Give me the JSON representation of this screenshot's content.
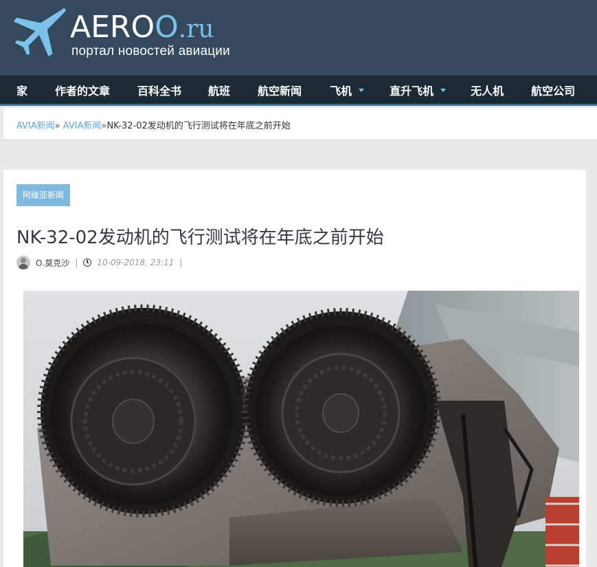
{
  "site": {
    "logo_main": "AERO",
    "logo_o": "O",
    "logo_tld": ".ru",
    "logo_subtitle": "портал новостей авиации"
  },
  "nav": {
    "items": [
      {
        "label": "家",
        "has_dropdown": false
      },
      {
        "label": "作者的文章",
        "has_dropdown": false
      },
      {
        "label": "百科全书",
        "has_dropdown": false
      },
      {
        "label": "航班",
        "has_dropdown": false
      },
      {
        "label": "航空新闻",
        "has_dropdown": false
      },
      {
        "label": "飞机",
        "has_dropdown": true
      },
      {
        "label": "直升飞机",
        "has_dropdown": true
      },
      {
        "label": "无人机",
        "has_dropdown": false
      },
      {
        "label": "航空公司",
        "has_dropdown": false
      }
    ]
  },
  "breadcrumb": {
    "link1": "AVIA新闻",
    "sep": "»",
    "link2": "AVIA新闻",
    "current": "NK-32-02发动机的飞行测试将在年底之前开始"
  },
  "article": {
    "category": "阿维亚新闻",
    "title": "NK-32-02发动机的飞行测试将在年底之前开始",
    "author": "О.莫克沙",
    "datetime": "10-09-2018,  23:11",
    "meta_sep": "|"
  },
  "colors": {
    "header_bg": "#34495e",
    "nav_bg": "#1c2a36",
    "accent": "#7cc1ea",
    "link": "#5fa6d6",
    "badge": "#7fb8df"
  }
}
